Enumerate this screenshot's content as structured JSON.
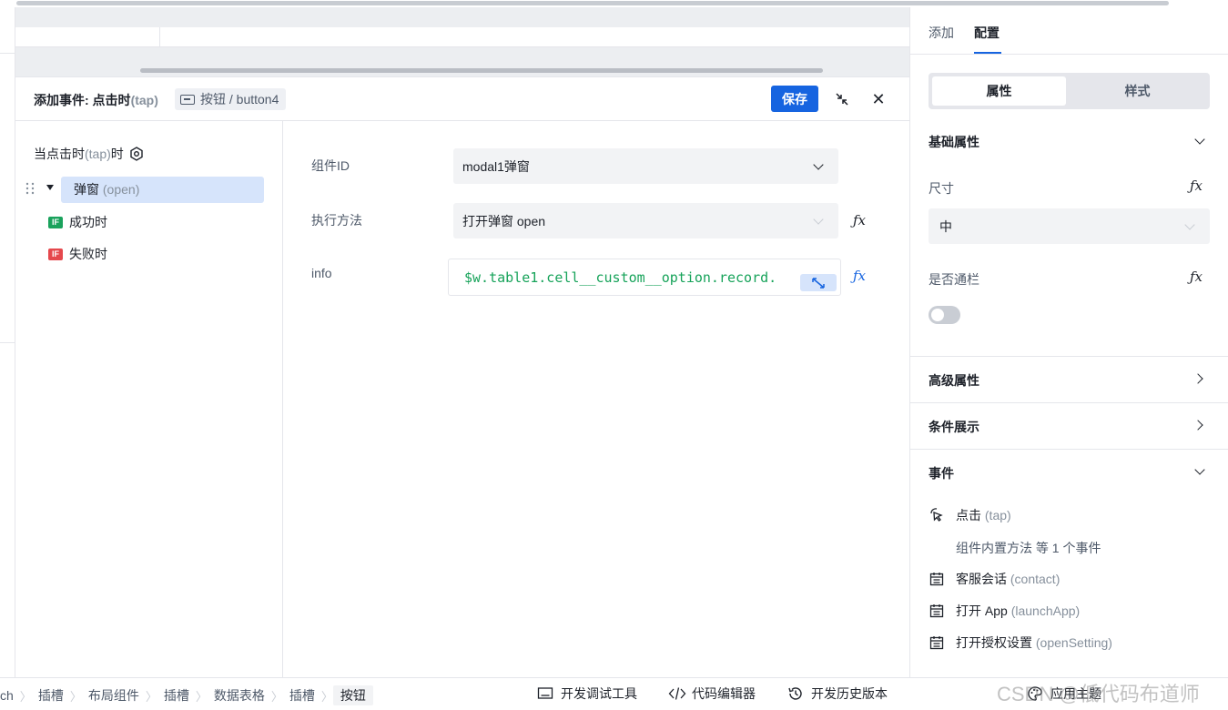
{
  "editor": {
    "title_prefix": "添加事件: 点击时",
    "title_event": "(tap)",
    "component_ref": "按钮 / button4",
    "save_label": "保存"
  },
  "tree": {
    "trigger_label": "当点击时",
    "trigger_event": "(tap)",
    "trigger_suffix": "时",
    "action_label": "弹窗",
    "action_method": "(open)",
    "success_badge": "IF",
    "success_label": "成功时",
    "fail_badge": "IF",
    "fail_label": "失败时"
  },
  "form": {
    "component_id_label": "组件ID",
    "component_id_value": "modal1弹窗",
    "method_label": "执行方法",
    "method_value": "打开弹窗 open",
    "info_label": "info",
    "info_value": "$w.table1.cell__custom__option.record."
  },
  "right_panel": {
    "tabs": [
      {
        "label": "添加"
      },
      {
        "label": "配置"
      }
    ],
    "active_tab": "配置",
    "segments": [
      {
        "label": "属性"
      },
      {
        "label": "样式"
      }
    ],
    "basic_props_title": "基础属性",
    "size_label": "尺寸",
    "size_value": "中",
    "block_label": "是否通栏",
    "block_value": false,
    "advanced_title": "高级属性",
    "condition_title": "条件展示",
    "events_title": "事件",
    "events": [
      {
        "label": "点击",
        "event": "(tap)",
        "icon": "tap-icon"
      },
      {
        "label": "客服会话",
        "event": "(contact)",
        "icon": "calendar-icon"
      },
      {
        "label": "打开 App",
        "event": "(launchApp)",
        "icon": "calendar-icon"
      },
      {
        "label": "打开授权设置",
        "event": "(openSetting)",
        "icon": "calendar-icon"
      }
    ],
    "tap_sub": "组件内置方法 等 1 个事件"
  },
  "bottom": {
    "breadcrumbs": [
      "ch",
      "插槽",
      "布局组件",
      "插槽",
      "数据表格",
      "插槽",
      "按钮"
    ],
    "devtools_label": "开发调试工具",
    "code_editor_label": "代码编辑器",
    "history_label": "开发历史版本",
    "theme_label": "应用主题",
    "watermark": "CSDN @低代码布道师"
  },
  "colors": {
    "primary": "#1664e0",
    "selected_bg": "#d6e4fb",
    "success_badge": "#1aa25c",
    "fail_badge": "#e5484d",
    "code_text": "#17a35a"
  }
}
